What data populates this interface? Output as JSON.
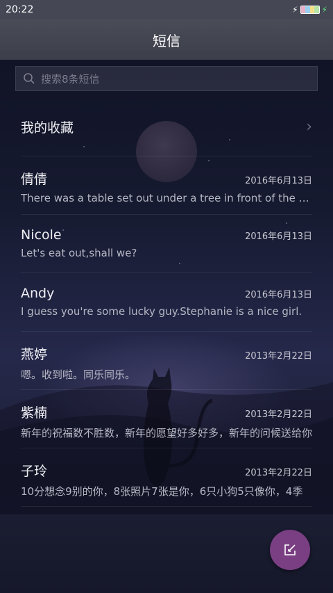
{
  "status": {
    "time": "20:22"
  },
  "header": {
    "title": "短信"
  },
  "search": {
    "placeholder": "搜索8条短信",
    "icon": "search-icon"
  },
  "favorites": {
    "label": "我的收藏",
    "icon": "chevron-right-icon"
  },
  "conversations": [
    {
      "name": "倩倩",
      "date": "2016年6月13日",
      "snippet": "There was a table set out under a tree in front of the house"
    },
    {
      "name": "Nicole",
      "date": "2016年6月13日",
      "snippet": "Let's eat out,shall we?"
    },
    {
      "name": "Andy",
      "date": "2016年6月13日",
      "snippet": "I guess you're some lucky guy.Stephanie is a nice girl."
    },
    {
      "name": "燕婷",
      "date": "2013年2月22日",
      "snippet": "嗯。收到啦。同乐同乐。"
    },
    {
      "name": "紫楠",
      "date": "2013年2月22日",
      "snippet": "新年的祝福数不胜数，新年的愿望好多好多，新年的问候送给你"
    },
    {
      "name": "子玲",
      "date": "2013年2月22日",
      "snippet": "10分想念9别的你，8张照片7张是你，6只小狗5只像你，4季"
    }
  ],
  "fab": {
    "icon": "compose-icon",
    "color": "#7a3f82"
  },
  "colors": {
    "background": "#141627",
    "title_bar": "#454754",
    "accent": "#7a3f82"
  }
}
